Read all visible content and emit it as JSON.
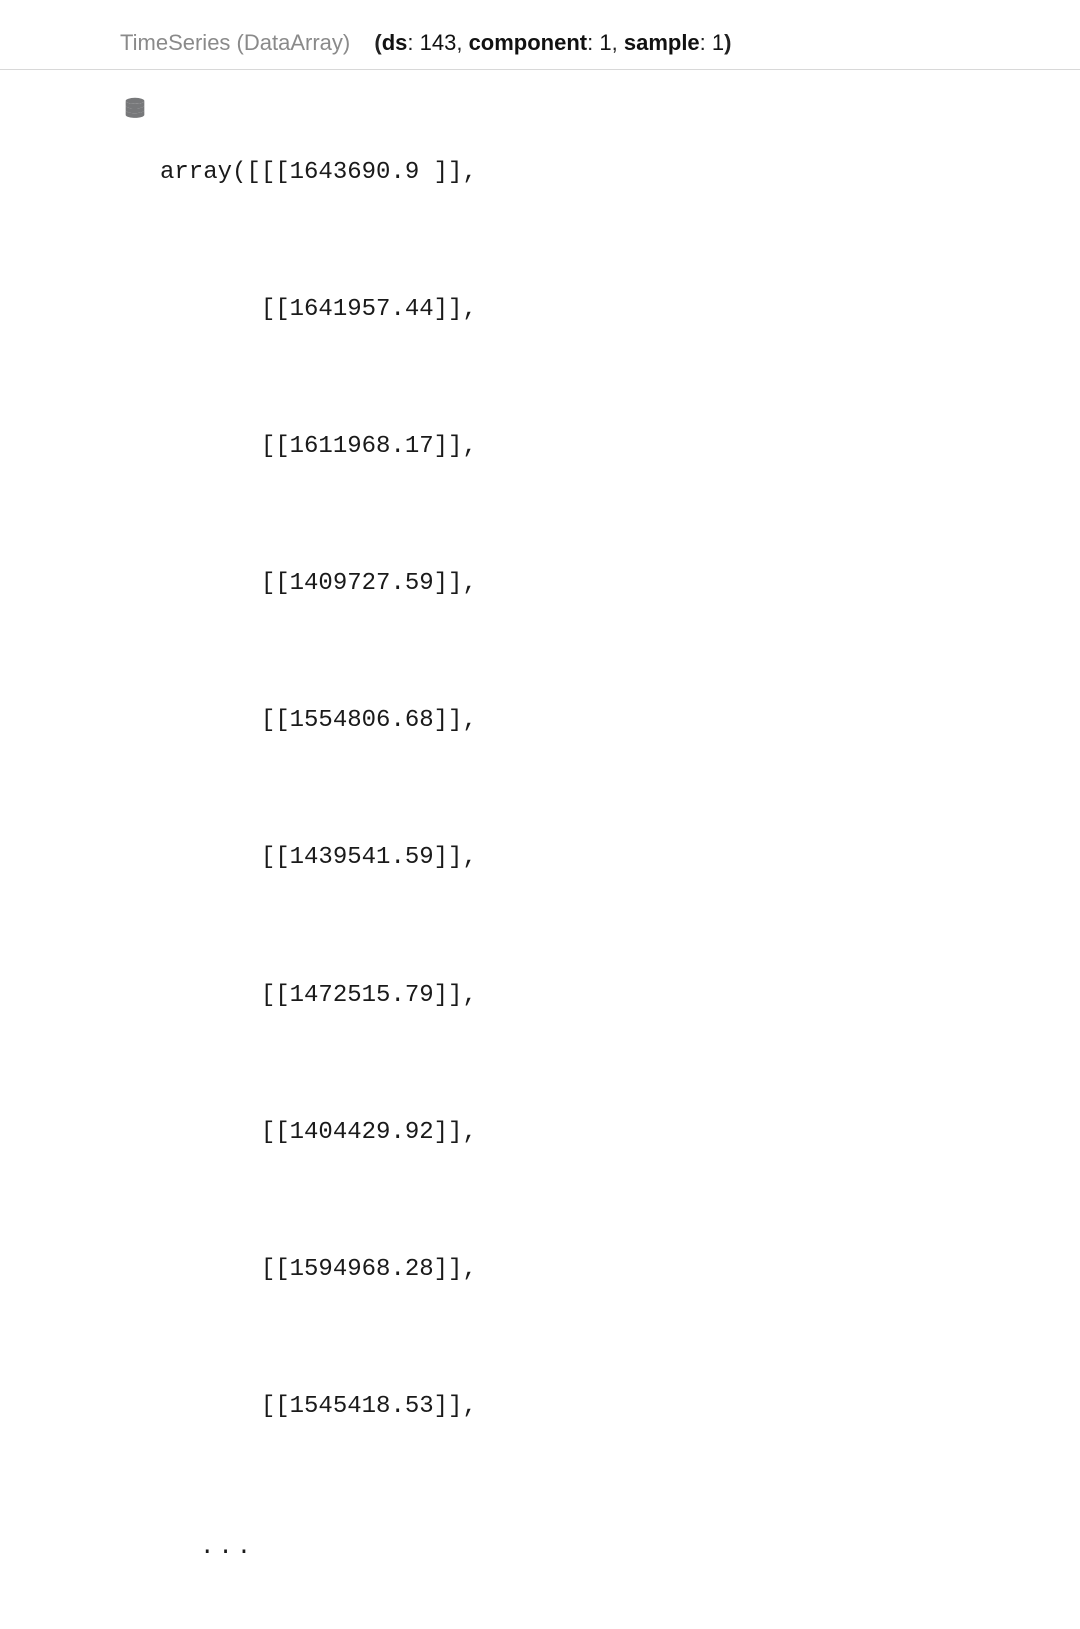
{
  "header": {
    "type_label": "TimeSeries (DataArray)",
    "dims": [
      {
        "name": "ds",
        "value": "143"
      },
      {
        "name": "component",
        "value": "1"
      },
      {
        "name": "sample",
        "value": "1"
      }
    ]
  },
  "array_values": [
    "1643690.9 ",
    "1641957.44",
    "1611968.17",
    "1409727.59",
    "1554806.68",
    "1439541.59",
    "1472515.79",
    "1404429.92",
    "1594968.28",
    "1545418.53"
  ],
  "ellipsis": "..."
}
